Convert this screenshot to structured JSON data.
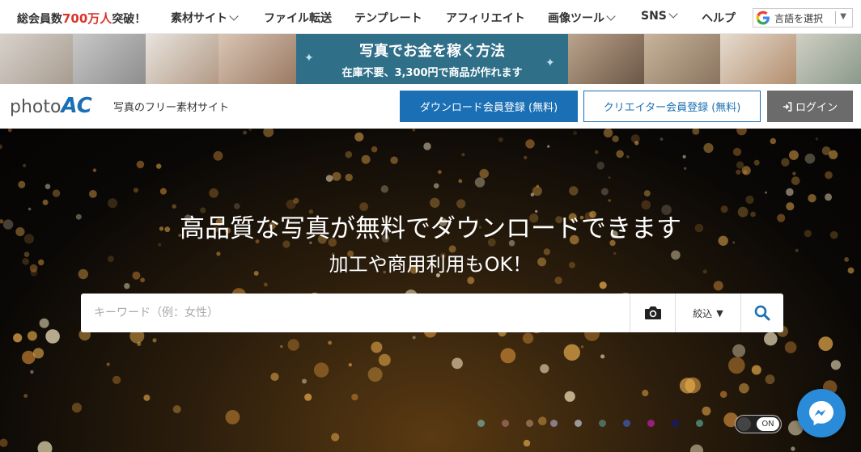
{
  "topbar": {
    "members_prefix": "総会員数",
    "members_count": "700万人",
    "members_suffix": "突破！",
    "nav": [
      {
        "label": "素材サイト",
        "dropdown": true
      },
      {
        "label": "ファイル転送",
        "dropdown": false
      },
      {
        "label": "テンプレート",
        "dropdown": false
      },
      {
        "label": "アフィリエイト",
        "dropdown": false
      },
      {
        "label": "画像ツール",
        "dropdown": true
      },
      {
        "label": "SNS",
        "dropdown": true
      },
      {
        "label": "ヘルプ",
        "dropdown": false
      }
    ],
    "language_select": "言語を選択"
  },
  "banner": {
    "title": "写真でお金を稼ぐ方法",
    "subtitle": "在庫不要、3,300円で商品が作れます"
  },
  "header": {
    "logo_photo": "photo",
    "logo_ac": "AC",
    "tagline": "写真のフリー素材サイト",
    "download_register": "ダウンロード会員登録 (無料)",
    "creator_register": "クリエイター会員登録 (無料)",
    "login": "ログイン"
  },
  "hero": {
    "headline": "高品質な写真が無料でダウンロードできます",
    "subheadline": "加工や商用利用もOK！",
    "search_placeholder": "キーワード（例：女性）",
    "search_value": "",
    "filter_label": "絞込",
    "toggle_label": "ON"
  },
  "colors": {
    "brand_blue": "#1a6fb5",
    "accent_red": "#d9342b",
    "login_gray": "#6b6b6b",
    "banner_teal": "#2f6f88",
    "messenger_blue": "#2a8bd8"
  },
  "carousel_dots": [
    "#6d8b78",
    "#8a5e4e",
    "#8b6a4a",
    "#8a7a8a",
    "#9a9a9a",
    "#4f6d5e",
    "#3a4d8a",
    "#9a1e7a",
    "#1a1a5a",
    "#4a7a6a"
  ],
  "icons": {
    "camera": "camera-icon",
    "search": "search-icon",
    "google": "google-icon",
    "login": "login-icon",
    "messenger": "messenger-icon"
  }
}
